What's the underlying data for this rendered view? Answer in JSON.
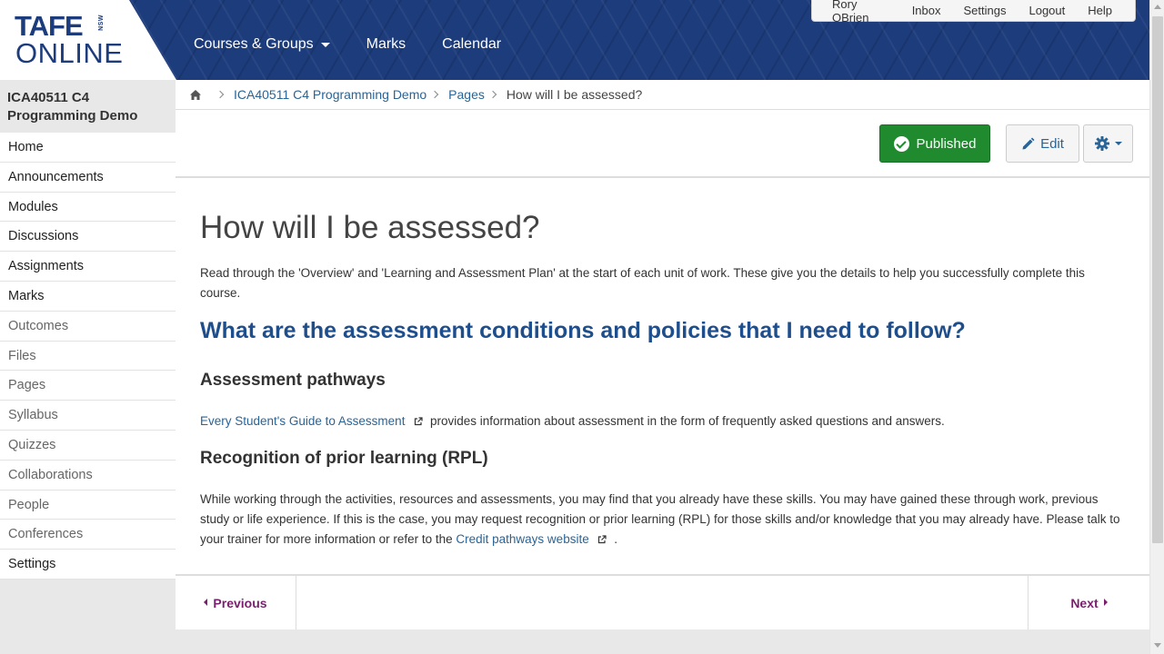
{
  "logo": {
    "line1": "TAFE",
    "nsw": "NSW",
    "line2": "ONLINE"
  },
  "mainnav": {
    "courses": "Courses & Groups",
    "marks": "Marks",
    "calendar": "Calendar"
  },
  "usermenu": {
    "user": "Rory OBrien",
    "inbox": "Inbox",
    "settings": "Settings",
    "logout": "Logout",
    "help": "Help"
  },
  "sidebar": {
    "course_title": "ICA40511 C4 Programming Demo",
    "items": [
      {
        "label": "Home"
      },
      {
        "label": "Announcements"
      },
      {
        "label": "Modules"
      },
      {
        "label": "Discussions"
      },
      {
        "label": "Assignments"
      },
      {
        "label": "Marks"
      },
      {
        "label": "Outcomes"
      },
      {
        "label": "Files"
      },
      {
        "label": "Pages"
      },
      {
        "label": "Syllabus"
      },
      {
        "label": "Quizzes"
      },
      {
        "label": "Collaborations"
      },
      {
        "label": "People"
      },
      {
        "label": "Conferences"
      },
      {
        "label": "Settings"
      }
    ]
  },
  "breadcrumb": {
    "course": "ICA40511 C4 Programming Demo",
    "pages": "Pages",
    "current": "How will I be assessed?"
  },
  "toolbar": {
    "published": "Published",
    "edit": "Edit"
  },
  "content": {
    "title": "How will I be assessed?",
    "intro": "Read through the 'Overview' and 'Learning and Assessment Plan' at the start of each unit of work. These give you the details to help you successfully complete this course.",
    "h2": "What are the assessment conditions and policies that I need to follow?",
    "h3_pathways": "Assessment pathways",
    "guide_link": "Every Student's Guide to Assessment",
    "guide_text": "provides information about assessment in the form of frequently asked questions and answers.",
    "h3_rpl": "Recognition of prior learning (RPL)",
    "rpl_text": "While working through the activities, resources and assessments, you may find that you already have these skills. You may have gained these through work, previous study or life experience. If this is the case, you may request recognition or prior learning (RPL) for those skills and/or knowledge that you may already have. Please talk to your trainer for more information or refer to the",
    "rpl_link": "Credit pathways website",
    "rpl_end": "."
  },
  "footer": {
    "previous": "Previous",
    "next": "Next"
  },
  "colors": {
    "header": "#1d3c7c",
    "published": "#1f8a2e",
    "link": "#2a6496",
    "nav_footer": "#7a1e6e"
  }
}
